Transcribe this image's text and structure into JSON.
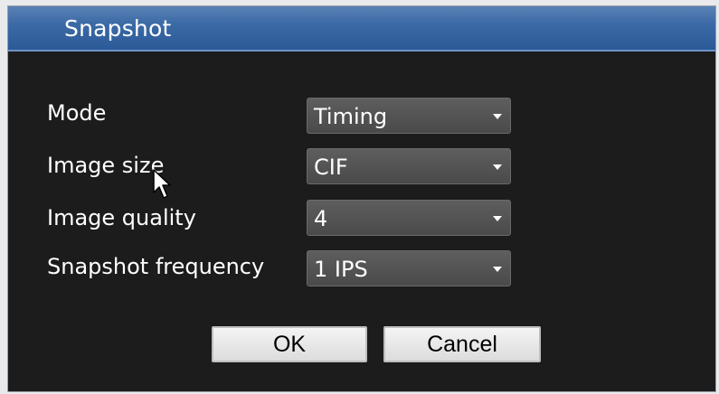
{
  "dialog": {
    "title": "Snapshot"
  },
  "fields": [
    {
      "label": "Mode",
      "value": "Timing"
    },
    {
      "label": "Image size",
      "value": "CIF"
    },
    {
      "label": "Image quality",
      "value": "4"
    },
    {
      "label": "Snapshot frequency",
      "value": "1 IPS"
    }
  ],
  "buttons": {
    "ok_label": "OK",
    "cancel_label": "Cancel"
  },
  "icons": {
    "dropdown": "chevron-down-icon",
    "pointer": "mouse-pointer-icon"
  },
  "colors": {
    "titlebar": "#3c6aa6",
    "dialog_background": "#1c1c1c",
    "select_background": "#555555",
    "button_background": "#e6e6e6",
    "text": "#ffffff"
  }
}
